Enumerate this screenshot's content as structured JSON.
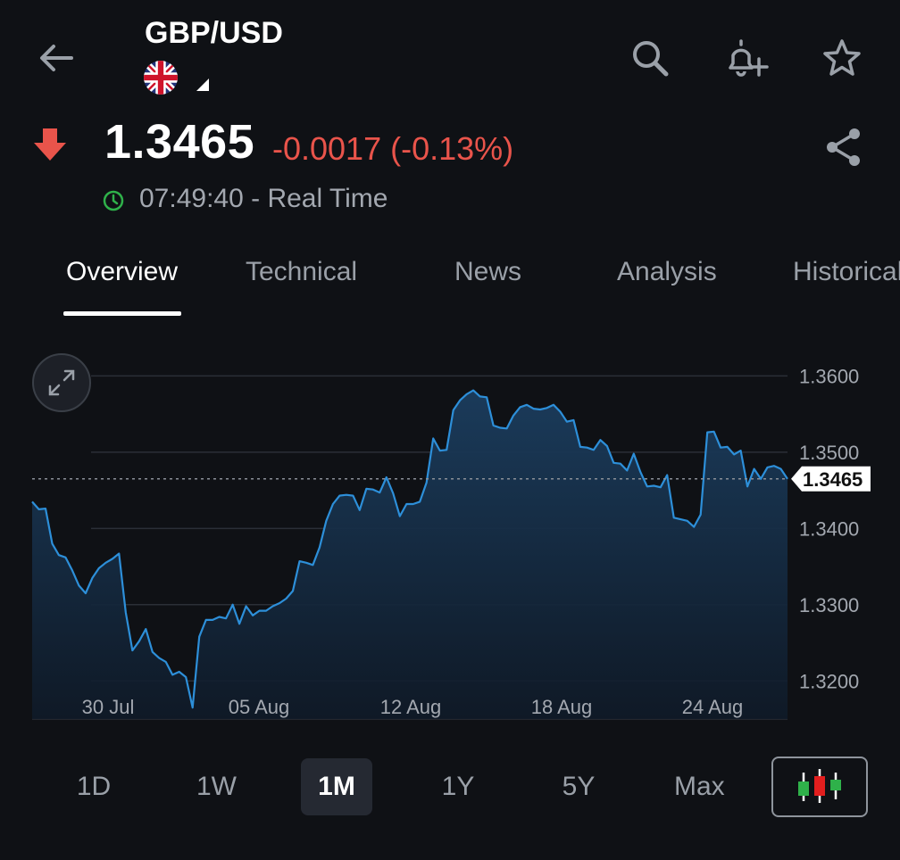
{
  "header": {
    "title": "GBP/USD",
    "icons": [
      "back-arrow-icon",
      "search-icon",
      "add-alert-bell-icon",
      "star-icon"
    ]
  },
  "quote": {
    "price": "1.3465",
    "change": "-0.0017 (-0.13%)",
    "time_status": "07:49:40 - Real Time",
    "colors": {
      "down": "#e9544b",
      "clock": "#2fb14a"
    }
  },
  "tabs": [
    {
      "label": "Overview",
      "active": true
    },
    {
      "label": "Technical",
      "active": false
    },
    {
      "label": "News",
      "active": false
    },
    {
      "label": "Analysis",
      "active": false
    },
    {
      "label": "Historical",
      "active": false
    }
  ],
  "chart_data": {
    "type": "area",
    "y_ticks": [
      "1.3600",
      "1.3500",
      "1.3400",
      "1.3300",
      "1.3200"
    ],
    "x_ticks": [
      "30 Jul",
      "05 Aug",
      "12 Aug",
      "18 Aug",
      "24 Aug"
    ],
    "ylim": [
      1.315,
      1.3625
    ],
    "current_label": "1.3465",
    "current_value": 1.3465,
    "grid": true,
    "line_color": "#2d8fd9",
    "values": [
      1.3435,
      1.3425,
      1.3426,
      1.338,
      1.3365,
      1.3362,
      1.3345,
      1.3325,
      1.3315,
      1.3335,
      1.3348,
      1.3355,
      1.336,
      1.3367,
      1.329,
      1.324,
      1.3252,
      1.3268,
      1.3238,
      1.323,
      1.3225,
      1.3208,
      1.3212,
      1.3205,
      1.3165,
      1.3258,
      1.328,
      1.328,
      1.3284,
      1.3282,
      1.33,
      1.3275,
      1.3298,
      1.3286,
      1.3292,
      1.3292,
      1.3298,
      1.3302,
      1.3308,
      1.3318,
      1.3357,
      1.3355,
      1.3352,
      1.3375,
      1.341,
      1.3432,
      1.3443,
      1.3444,
      1.3443,
      1.3424,
      1.3452,
      1.3451,
      1.3447,
      1.3467,
      1.3446,
      1.3416,
      1.3432,
      1.3432,
      1.3435,
      1.346,
      1.3518,
      1.3502,
      1.3503,
      1.3555,
      1.3568,
      1.3576,
      1.3581,
      1.3573,
      1.3572,
      1.3535,
      1.3532,
      1.3531,
      1.3548,
      1.3559,
      1.3562,
      1.3557,
      1.3556,
      1.3558,
      1.3562,
      1.3553,
      1.354,
      1.3542,
      1.3507,
      1.3506,
      1.3503,
      1.3516,
      1.3508,
      1.3486,
      1.3485,
      1.3476,
      1.3498,
      1.3474,
      1.3455,
      1.3456,
      1.3454,
      1.347,
      1.3414,
      1.3412,
      1.341,
      1.3402,
      1.3418,
      1.3526,
      1.3527,
      1.3506,
      1.3507,
      1.3497,
      1.3502,
      1.3455,
      1.3478,
      1.3465,
      1.348,
      1.3482,
      1.3478,
      1.3465
    ]
  },
  "ranges": [
    {
      "label": "1D",
      "active": false
    },
    {
      "label": "1W",
      "active": false
    },
    {
      "label": "1M",
      "active": true
    },
    {
      "label": "1Y",
      "active": false
    },
    {
      "label": "5Y",
      "active": false
    },
    {
      "label": "Max",
      "active": false
    }
  ]
}
